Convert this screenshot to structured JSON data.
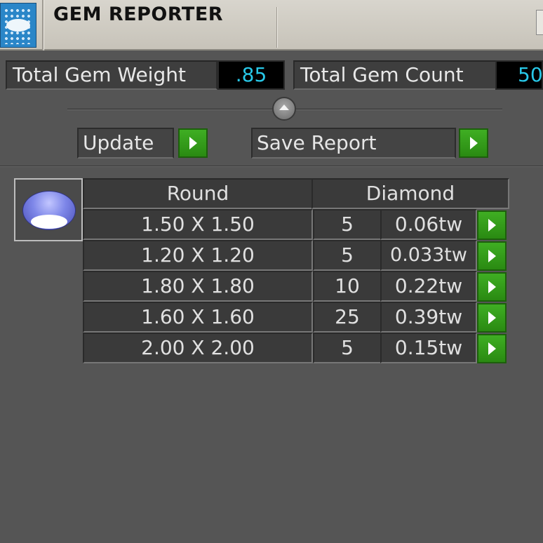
{
  "window": {
    "title": "GEM REPORTER",
    "icon": "gem-reporter-app-icon"
  },
  "stats": {
    "total_weight_label": "Total Gem Weight",
    "total_weight_value": ".85",
    "total_count_label": "Total Gem Count",
    "total_count_value": "50"
  },
  "actions": {
    "update_label": "Update",
    "save_report_label": "Save Report"
  },
  "table": {
    "shape": "Round",
    "material": "Diamond",
    "rows": [
      {
        "size": "1.50 X 1.50",
        "count": "5",
        "weight": "0.06tw"
      },
      {
        "size": "1.20 X 1.20",
        "count": "5",
        "weight": "0.033tw"
      },
      {
        "size": "1.80 X 1.80",
        "count": "10",
        "weight": "0.22tw"
      },
      {
        "size": "1.60 X 1.60",
        "count": "25",
        "weight": "0.39tw"
      },
      {
        "size": "2.00 X 2.00",
        "count": "5",
        "weight": "0.15tw"
      }
    ]
  },
  "colors": {
    "background": "#555555",
    "value_text": "#28c8e8",
    "play_button": "#3fae23",
    "gem": "#7d86e8"
  }
}
